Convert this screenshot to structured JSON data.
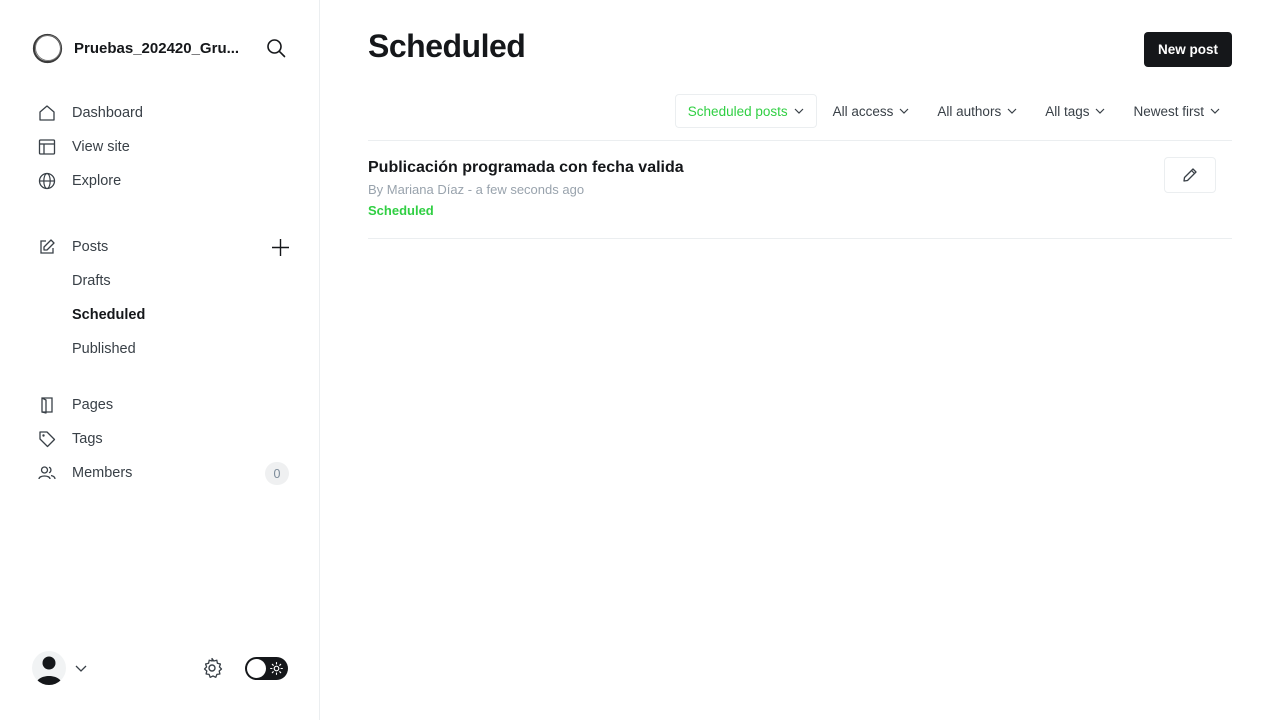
{
  "site": {
    "title": "Pruebas_202420_Gru..."
  },
  "sidebar": {
    "items": [
      {
        "label": "Dashboard",
        "icon": "home-icon"
      },
      {
        "label": "View site",
        "icon": "layout-icon"
      },
      {
        "label": "Explore",
        "icon": "globe-icon"
      }
    ],
    "posts": {
      "label": "Posts",
      "icon": "edit-icon",
      "sub": [
        {
          "label": "Drafts",
          "active": false
        },
        {
          "label": "Scheduled",
          "active": true
        },
        {
          "label": "Published",
          "active": false
        }
      ]
    },
    "bottom_items": [
      {
        "label": "Pages",
        "icon": "page-icon"
      },
      {
        "label": "Tags",
        "icon": "tag-icon"
      },
      {
        "label": "Members",
        "icon": "members-icon",
        "badge": "0"
      }
    ]
  },
  "main": {
    "title": "Scheduled",
    "new_post_label": "New post",
    "filters": [
      {
        "label": "Scheduled posts",
        "highlighted": true
      },
      {
        "label": "All access",
        "highlighted": false
      },
      {
        "label": "All authors",
        "highlighted": false
      },
      {
        "label": "All tags",
        "highlighted": false
      },
      {
        "label": "Newest first",
        "highlighted": false
      }
    ],
    "posts": [
      {
        "title": "Publicación programada con fecha valida",
        "meta": "By Mariana Díaz - a few seconds ago",
        "status": "Scheduled"
      }
    ]
  },
  "colors": {
    "accent_green": "#30cf43",
    "dark": "#15171a",
    "border": "#ebeef0",
    "muted": "#99a3ad"
  }
}
